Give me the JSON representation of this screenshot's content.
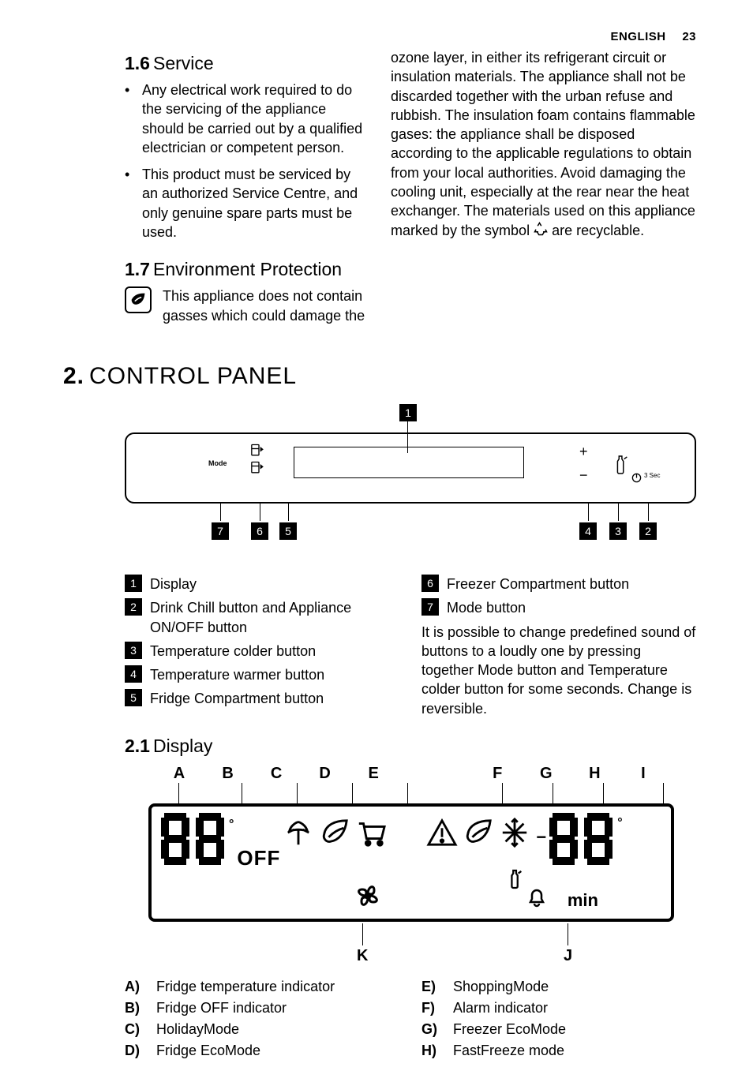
{
  "header": {
    "lang": "ENGLISH",
    "page": "23"
  },
  "s16": {
    "num": "1.6",
    "title": "Service",
    "bullets": [
      "Any electrical work required to do the servicing of the appliance should be carried out by a qualified electrician or competent person.",
      "This product must be serviced by an authorized Service Centre, and only genuine spare parts must be used."
    ]
  },
  "s17": {
    "num": "1.7",
    "title": "Environment Protection",
    "part1": "This appliance does not contain gasses which could damage the",
    "part2": "ozone layer, in either its refrigerant circuit or insulation materials. The appliance shall not be discarded together with the urban refuse and rubbish. The insulation foam contains flammable gases: the appliance shall be disposed according to the applicable regulations to obtain from your local authorities. Avoid damaging the cooling unit, especially at the rear near the heat exchanger. The materials used on this appliance marked by the symbol ",
    "part3": " are recyclable."
  },
  "s2": {
    "num": "2.",
    "title": "CONTROL PANEL"
  },
  "panel": {
    "mode": "Mode",
    "sec3": "3 Sec",
    "callouts": {
      "1": "Display",
      "2": "Drink Chill button and Appliance ON/OFF button",
      "3": "Temperature colder button",
      "4": "Temperature warmer button",
      "5": "Fridge Compartment button",
      "6": "Freezer Compartment button",
      "7": "Mode button"
    },
    "note": "It is possible to change predefined sound of buttons to a loudly one by pressing together Mode button and Temperature colder button for some seconds. Change is reversible."
  },
  "s21": {
    "num": "2.1",
    "title": "Display"
  },
  "display": {
    "letters_top": [
      "A",
      "B",
      "C",
      "D",
      "E",
      "F",
      "G",
      "H",
      "I"
    ],
    "letters_bottom": {
      "K": "K",
      "J": "J"
    },
    "off": "OFF",
    "min": "min",
    "legend": {
      "A": "Fridge temperature indicator",
      "B": "Fridge OFF indicator",
      "C": "HolidayMode",
      "D": "Fridge EcoMode",
      "E": "ShoppingMode",
      "F": "Alarm indicator",
      "G": "Freezer EcoMode",
      "H": "FastFreeze mode"
    }
  }
}
